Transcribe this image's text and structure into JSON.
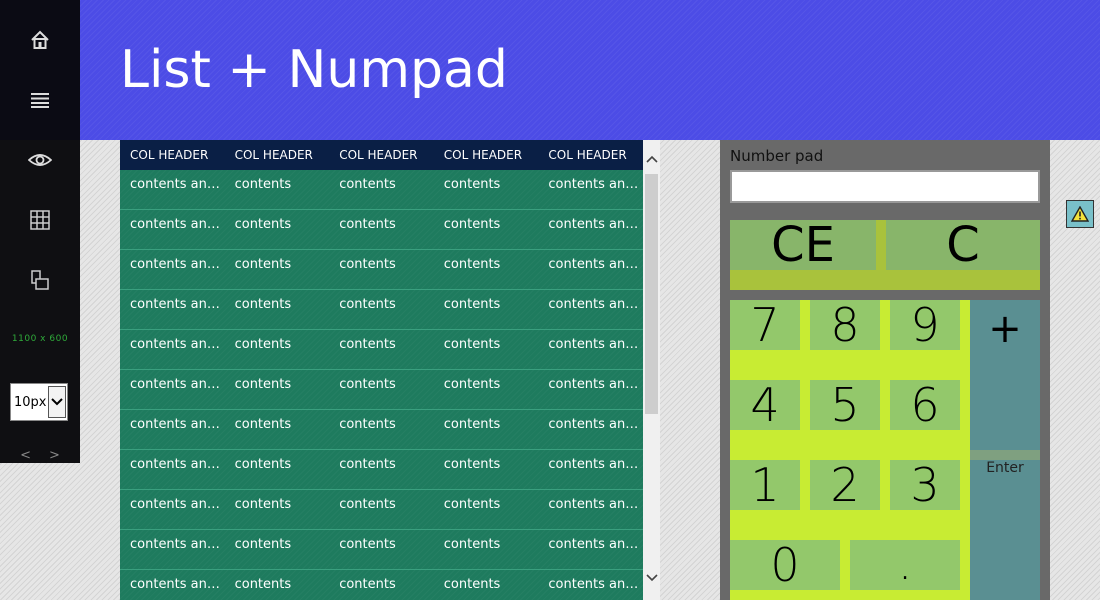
{
  "header": {
    "title": "List + Numpad",
    "bg_color": "#4c4ce6"
  },
  "side_nav": {
    "icons": [
      "home-icon",
      "menu-icon",
      "eye-icon",
      "grid-icon",
      "layout-icon"
    ],
    "resolution_label": "1100 x 600",
    "size_select": {
      "value": "10px"
    },
    "prev_label": "<",
    "next_label": ">"
  },
  "grid": {
    "columns": [
      "COL HEADER",
      "COL HEADER",
      "COL HEADER",
      "COL HEADER",
      "COL HEADER"
    ],
    "rows": [
      [
        "contents and more",
        "contents",
        "contents",
        "contents",
        "contents and more"
      ],
      [
        "contents and more",
        "contents",
        "contents",
        "contents",
        "contents and more"
      ],
      [
        "contents and more",
        "contents",
        "contents",
        "contents",
        "contents and more"
      ],
      [
        "contents and more",
        "contents",
        "contents",
        "contents",
        "contents and more"
      ],
      [
        "contents and more",
        "contents",
        "contents",
        "contents",
        "contents and more"
      ],
      [
        "contents and more",
        "contents",
        "contents",
        "contents",
        "contents and more"
      ],
      [
        "contents and more",
        "contents",
        "contents",
        "contents",
        "contents and more"
      ],
      [
        "contents and more",
        "contents",
        "contents",
        "contents",
        "contents and more"
      ],
      [
        "contents and more",
        "contents",
        "contents",
        "contents",
        "contents and more"
      ],
      [
        "contents and more",
        "contents",
        "contents",
        "contents",
        "contents and more"
      ],
      [
        "contents and more",
        "contents",
        "contents",
        "contents",
        "contents and more"
      ]
    ],
    "row_color": "#1e7b5e",
    "header_color": "#0a1f45"
  },
  "numpad": {
    "label": "Number pad",
    "input_value": "",
    "clear_entry": "CE",
    "clear": "C",
    "digits": [
      "7",
      "8",
      "9",
      "4",
      "5",
      "6",
      "1",
      "2",
      "3"
    ],
    "zero": "0",
    "decimal": ".",
    "plus": "+",
    "enter": "Enter"
  },
  "warning_icon": "warning-icon"
}
